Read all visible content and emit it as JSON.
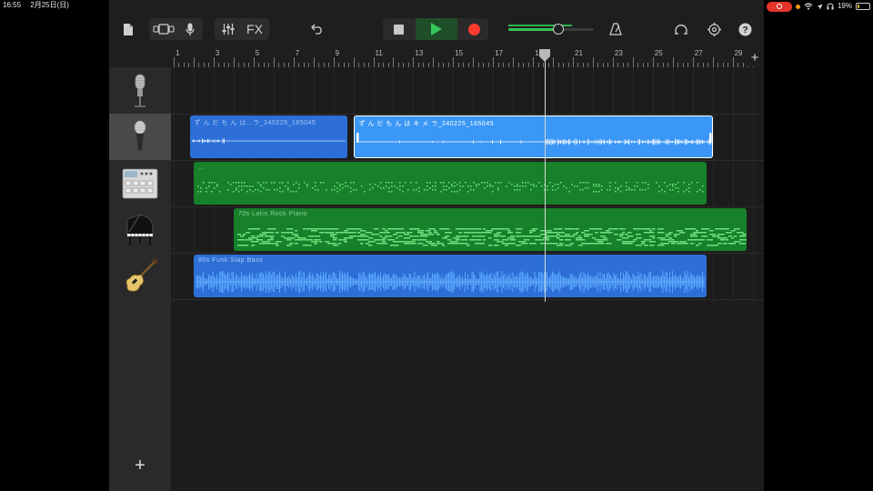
{
  "status_bar": {
    "time": "16:55",
    "date": "2月25日(日)",
    "battery": "19%",
    "battery_level": 0.19
  },
  "toolbar": {
    "fx_label": "FX",
    "volume_level": 0.58
  },
  "ruler": {
    "bar_numbers": [
      "1",
      "3",
      "5",
      "7",
      "9",
      "11",
      "13",
      "15",
      "17",
      "19",
      "21",
      "23",
      "25",
      "27",
      "29"
    ],
    "playhead_bar": 19.6
  },
  "tracks": [
    {
      "name": "track-1-vocal-mic",
      "icon": "studio-microphone-icon",
      "selected": false,
      "regions": []
    },
    {
      "name": "track-2-audio-recorder",
      "icon": "handheld-microphone-icon",
      "selected": true,
      "regions": [
        {
          "label": "ず ん だ も ん は…ラ_240225_165045",
          "start": 1.8,
          "end": 9.7,
          "kind": "audio-flat"
        },
        {
          "label": "ず ん だ も ん は キ メ ラ_240225_165045",
          "start": 10.0,
          "end": 28.0,
          "kind": "audio-selected"
        }
      ]
    },
    {
      "name": "track-3-drum-machine",
      "icon": "drum-machine-icon",
      "selected": false,
      "regions": [
        {
          "label": "…",
          "start": 2.0,
          "end": 27.7,
          "kind": "midi"
        }
      ]
    },
    {
      "name": "track-4-piano",
      "icon": "grand-piano-icon",
      "selected": false,
      "regions": [
        {
          "label": "70s Latin Rock Piano",
          "start": 4.0,
          "end": 29.7,
          "kind": "midi"
        }
      ]
    },
    {
      "name": "track-5-bass",
      "icon": "bass-guitar-icon",
      "selected": false,
      "regions": [
        {
          "label": "80s Funk Slap Bass",
          "start": 2.0,
          "end": 27.7,
          "kind": "audio-wave"
        }
      ]
    }
  ],
  "colors": {
    "audio_blue": "#2d6fd6",
    "audio_selected": "#3b97f5",
    "midi_green": "#17802a",
    "play_green": "#34c759",
    "record_red": "#ff3b30"
  }
}
